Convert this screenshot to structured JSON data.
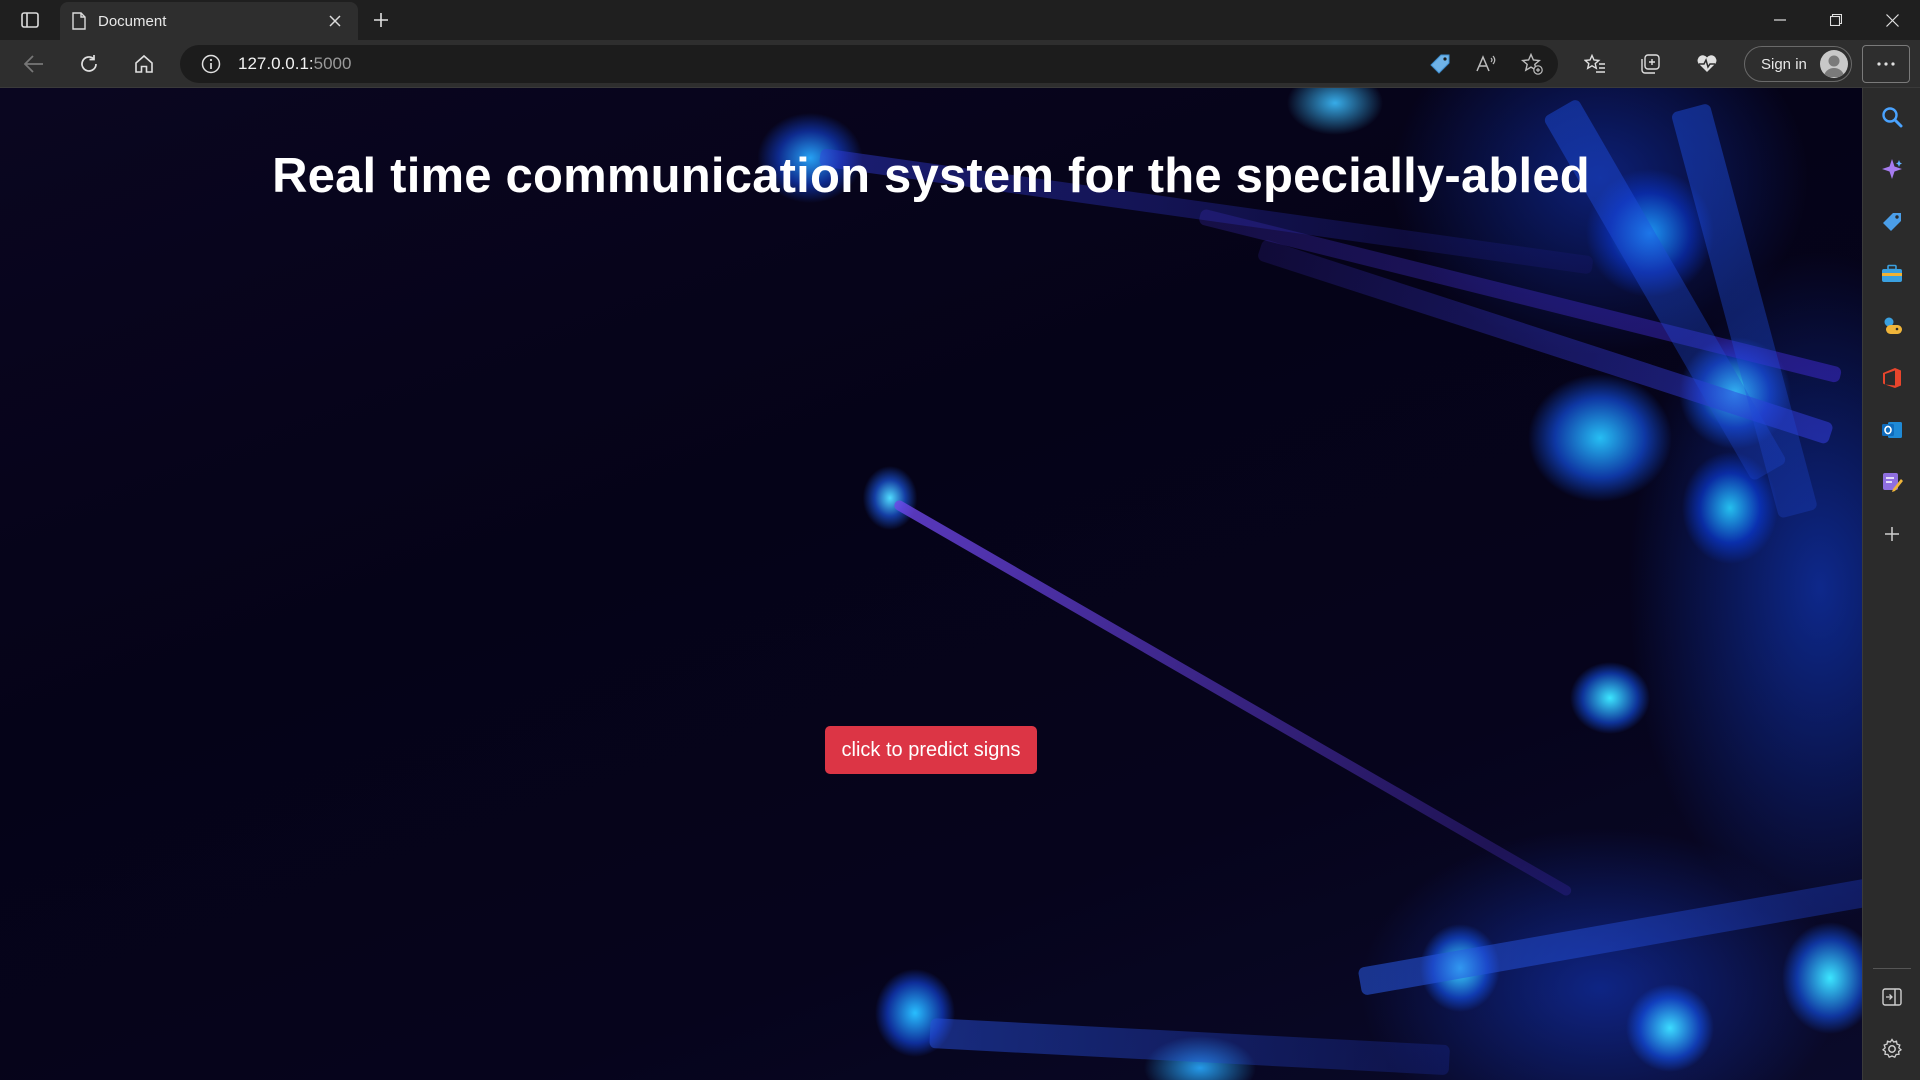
{
  "browser": {
    "tab": {
      "title": "Document"
    },
    "address": {
      "host": "127.0.0.1:",
      "port": "5000"
    },
    "signin_label": "Sign in"
  },
  "page": {
    "title": "Real time communication system for the specially-abled",
    "predict_button_label": "click to predict signs"
  },
  "colors": {
    "button_red": "#dc3545",
    "background_dark": "#050318",
    "accent_blue": "#28aaff"
  },
  "icons": {
    "toolbar": [
      "back-icon",
      "refresh-icon",
      "home-icon",
      "info-icon",
      "shopping-tag-icon",
      "read-aloud-icon",
      "add-favorite-icon",
      "favorites-icon",
      "collections-icon",
      "browser-essentials-icon",
      "profile-icon",
      "more-icon"
    ],
    "sidebar": [
      "search-icon",
      "copilot-icon",
      "shopping-icon",
      "tools-icon",
      "games-icon",
      "office-icon",
      "outlook-icon",
      "drop-icon",
      "add-icon",
      "hide-sidebar-icon",
      "settings-icon"
    ]
  }
}
